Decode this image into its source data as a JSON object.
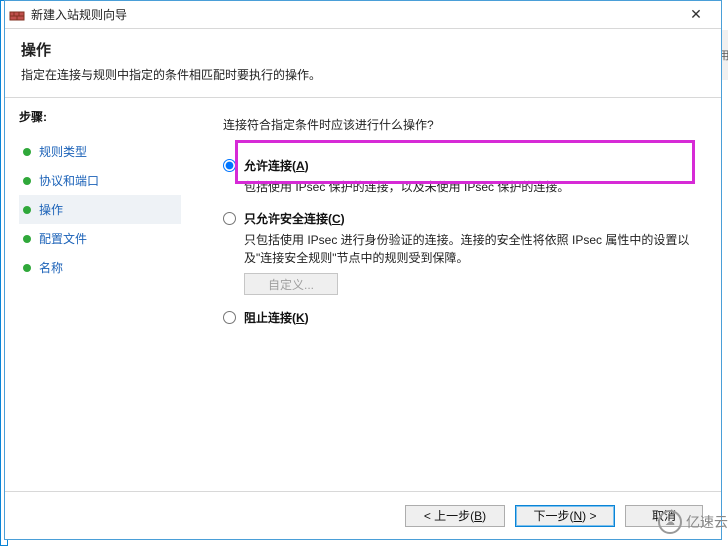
{
  "titlebar": {
    "title": "新建入站规则向导"
  },
  "header": {
    "title": "操作",
    "desc": "指定在连接与规则中指定的条件相匹配时要执行的操作。"
  },
  "steps": {
    "label": "步骤:",
    "items": [
      {
        "label": "规则类型"
      },
      {
        "label": "协议和端口"
      },
      {
        "label": "操作"
      },
      {
        "label": "配置文件"
      },
      {
        "label": "名称"
      }
    ]
  },
  "content": {
    "prompt": "连接符合指定条件时应该进行什么操作?",
    "options": {
      "allow": {
        "label_pre": "允许连接(",
        "hotkey": "A",
        "label_post": ")",
        "desc": "包括使用 IPsec 保护的连接，以及未使用 IPsec 保护的连接。"
      },
      "secure": {
        "label_pre": "只允许安全连接(",
        "hotkey": "C",
        "label_post": ")",
        "desc": "只包括使用 IPsec 进行身份验证的连接。连接的安全性将依照 IPsec 属性中的设置以及\"连接安全规则\"节点中的规则受到保障。",
        "customize": "自定义..."
      },
      "block": {
        "label_pre": "阻止连接(",
        "hotkey": "K",
        "label_post": ")"
      }
    }
  },
  "footer": {
    "back_pre": "< 上一步(",
    "back_hot": "B",
    "back_post": ")",
    "next_pre": "下一步(",
    "next_hot": "N",
    "next_post": ") >",
    "cancel": "取消"
  },
  "right_edge": "用",
  "watermark": "亿速云"
}
